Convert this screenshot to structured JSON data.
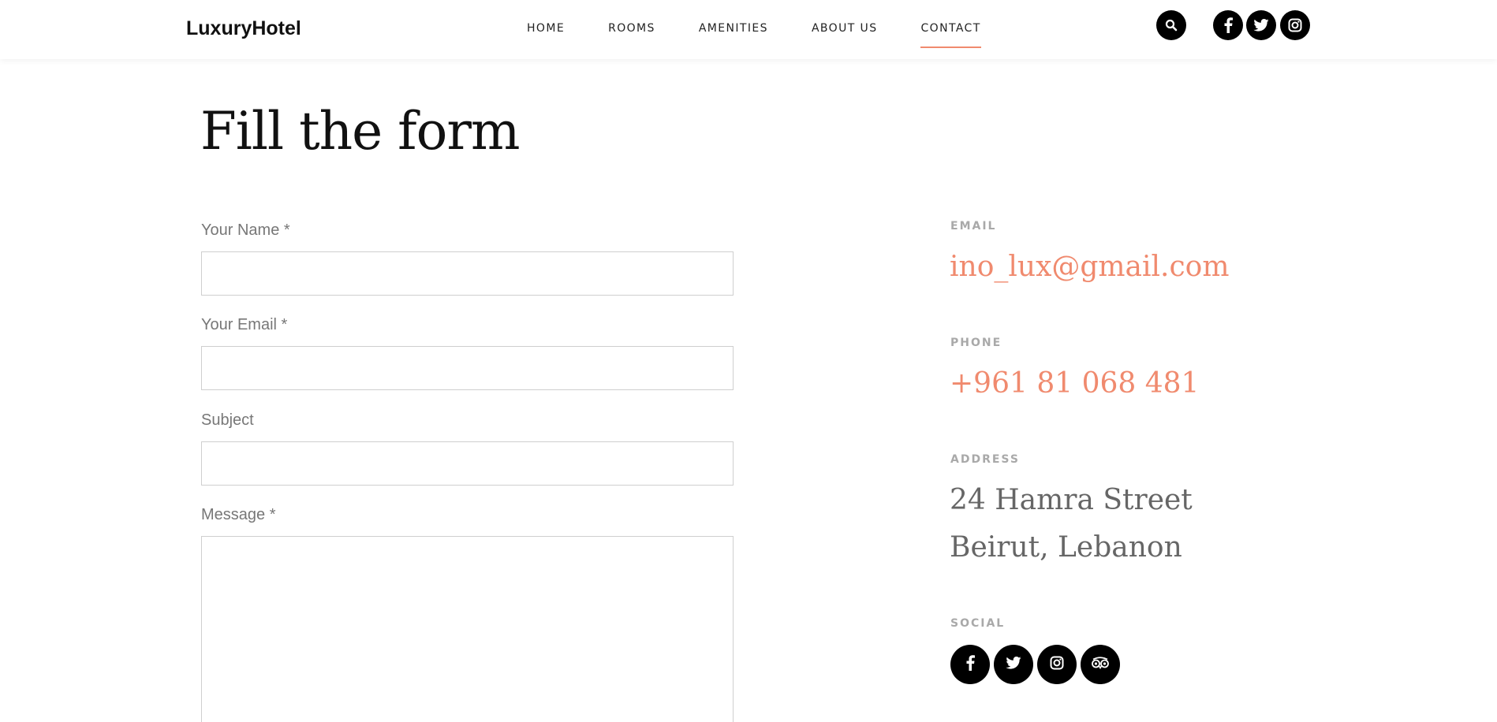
{
  "header": {
    "logo": "LuxuryHotel",
    "nav": [
      {
        "label": "HOME"
      },
      {
        "label": "ROOMS"
      },
      {
        "label": "AMENITIES"
      },
      {
        "label": "ABOUT US"
      },
      {
        "label": "CONTACT",
        "active": true
      }
    ],
    "icons": [
      "search-icon",
      "facebook-icon",
      "twitter-icon",
      "instagram-icon"
    ]
  },
  "form": {
    "title": "Fill the form",
    "name_label": "Your Name *",
    "name_value": "",
    "email_label": "Your Email *",
    "email_value": "",
    "subject_label": "Subject",
    "subject_value": "",
    "message_label": "Message *",
    "message_value": ""
  },
  "contact_info": {
    "email_label": "EMAIL",
    "email": "ino_lux@gmail.com",
    "phone_label": "PHONE",
    "phone": "+961 81 068 481",
    "address_label": "ADDRESS",
    "address_line1": "24 Hamra Street",
    "address_line2": "Beirut, Lebanon",
    "social_label": "SOCIAL",
    "social_icons": [
      "facebook-icon",
      "twitter-icon",
      "instagram-icon",
      "tripadvisor-icon"
    ]
  },
  "colors": {
    "accent": "#f08a6e",
    "label_gray": "#a9a9a9",
    "text_gray": "#777777",
    "icon_bg": "#000000"
  }
}
